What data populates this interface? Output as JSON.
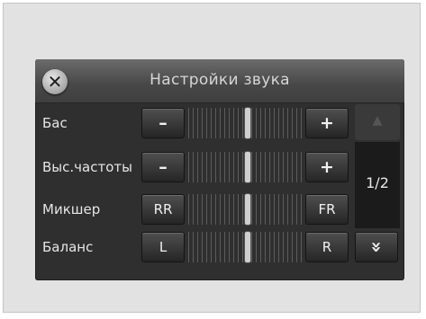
{
  "dialog": {
    "title": "Настройки звука",
    "close_icon": "close-icon"
  },
  "rows": [
    {
      "label": "Бас",
      "left": "–",
      "right": "+"
    },
    {
      "label": "Выс.частоты",
      "left": "–",
      "right": "+"
    },
    {
      "label": "Микшер",
      "left": "RR",
      "right": "FR"
    },
    {
      "label": "Баланс",
      "left": "L",
      "right": "R"
    }
  ],
  "pager": {
    "page": "1/2",
    "down_glyph": "»",
    "up_icon": "chevron-up-icon",
    "down_icon": "chevron-double-down-icon"
  }
}
